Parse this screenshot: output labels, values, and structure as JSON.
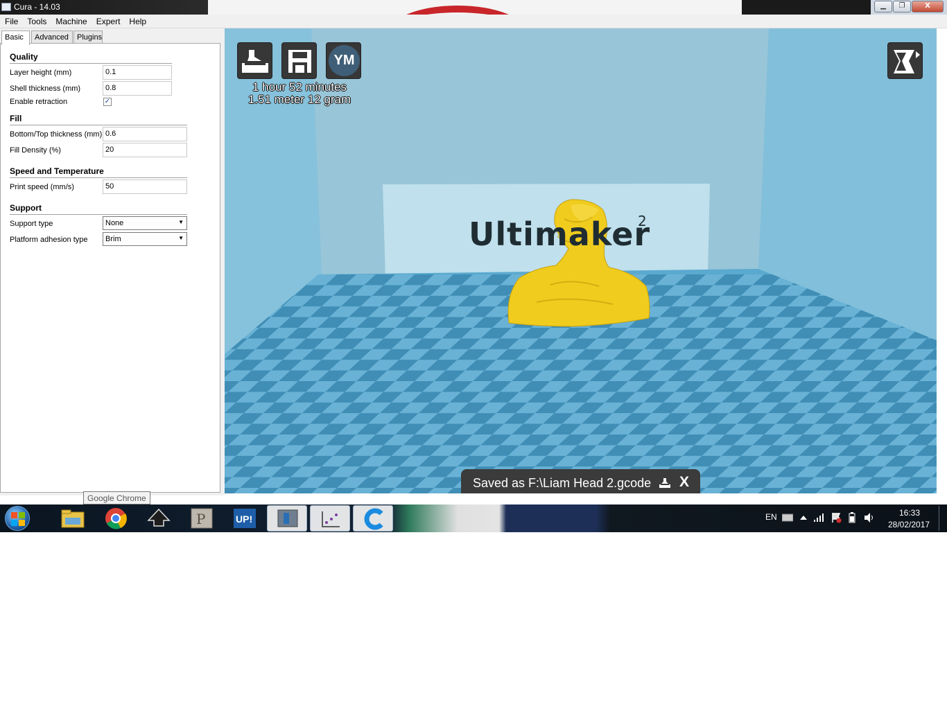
{
  "window": {
    "title": "Cura - 14.03",
    "minimize_label": "▁",
    "maximize_label": "❐",
    "close_label": "X"
  },
  "menu": [
    "File",
    "Tools",
    "Machine",
    "Expert",
    "Help"
  ],
  "tabs": [
    "Basic",
    "Advanced",
    "Plugins"
  ],
  "settings": {
    "quality": {
      "title": "Quality",
      "layer_height_label": "Layer height (mm)",
      "layer_height_value": "0.1",
      "shell_thickness_label": "Shell thickness (mm)",
      "shell_thickness_value": "0.8",
      "enable_retraction_label": "Enable retraction",
      "enable_retraction_checked": true
    },
    "fill": {
      "title": "Fill",
      "bottom_top_label": "Bottom/Top thickness (mm)",
      "bottom_top_value": "0.6",
      "fill_density_label": "Fill Density (%)",
      "fill_density_value": "20"
    },
    "speed": {
      "title": "Speed and Temperature",
      "print_speed_label": "Print speed (mm/s)",
      "print_speed_value": "50"
    },
    "support": {
      "title": "Support",
      "support_type_label": "Support type",
      "support_type_value": "None",
      "adhesion_label": "Platform adhesion type",
      "adhesion_value": "Brim"
    }
  },
  "viewport": {
    "ym_label": "YM",
    "print_time": "1 hour 52 minutes",
    "print_material": "1.51 meter 12 gram",
    "brand_text": "Ultimaker",
    "brand_superscript": "2",
    "toast_text": "Saved as F:\\Liam Head 2.gcode",
    "toast_close": "X",
    "model_color": "#f0cc1e",
    "floor_color_light": "#6ab3d6",
    "floor_color_dark": "#3f8db5"
  },
  "tooltip": "Google Chrome",
  "taskbar": {
    "apps": [
      "windows-explorer",
      "google-chrome",
      "inkscape",
      "pdf-app",
      "up-printer",
      "cura-active",
      "plot-app",
      "cura-app"
    ],
    "up_label": "UP!",
    "language": "EN",
    "time": "16:33",
    "date": "28/02/2017"
  }
}
